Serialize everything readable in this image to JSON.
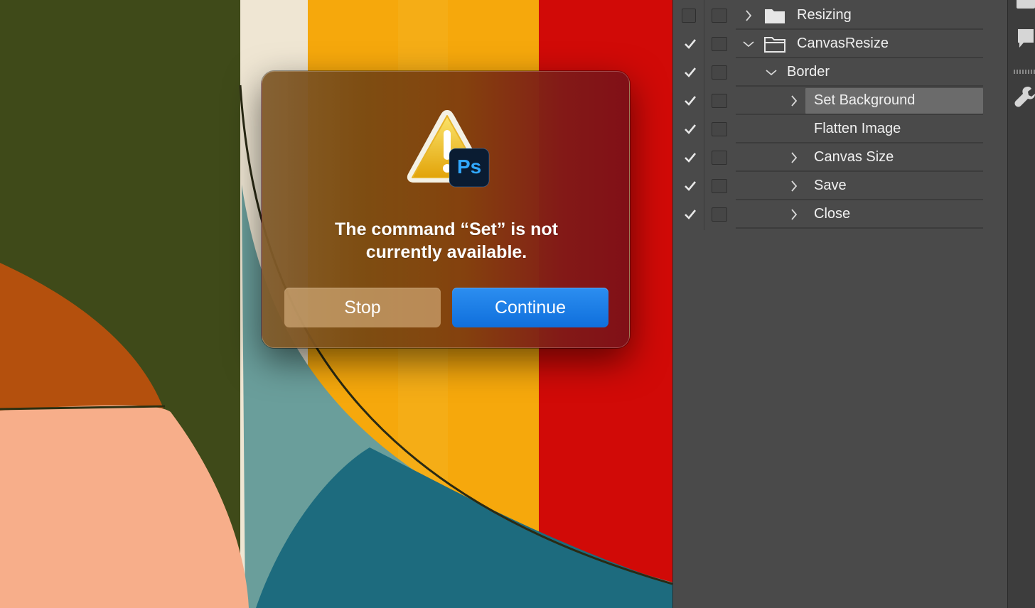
{
  "dialog": {
    "message_line1": "The command “Set” is not",
    "message_line2": "currently available.",
    "stop_label": "Stop",
    "continue_label": "Continue",
    "app_badge": "Ps",
    "icon": "warning-triangle-icon",
    "accent": "#1a7ae8"
  },
  "actions_panel": {
    "rows": [
      {
        "label": "Resizing",
        "checked": false,
        "expand": "collapsed",
        "folder": true
      },
      {
        "label": "CanvasResize",
        "checked": true,
        "expand": "expanded",
        "folder": true
      },
      {
        "label": "Border",
        "checked": true,
        "expand": "expanded",
        "folder": false
      },
      {
        "label": "Set Background",
        "checked": true,
        "expand": "collapsed",
        "folder": false,
        "selected": true
      },
      {
        "label": "Flatten Image",
        "checked": true,
        "expand": "none",
        "folder": false
      },
      {
        "label": "Canvas Size",
        "checked": true,
        "expand": "collapsed",
        "folder": false
      },
      {
        "label": "Save",
        "checked": true,
        "expand": "collapsed",
        "folder": false
      },
      {
        "label": "Close",
        "checked": true,
        "expand": "collapsed",
        "folder": false
      }
    ]
  },
  "toolbar_strip": {
    "icons": [
      "play-icon",
      "comment-icon",
      "wrench-icon"
    ]
  }
}
